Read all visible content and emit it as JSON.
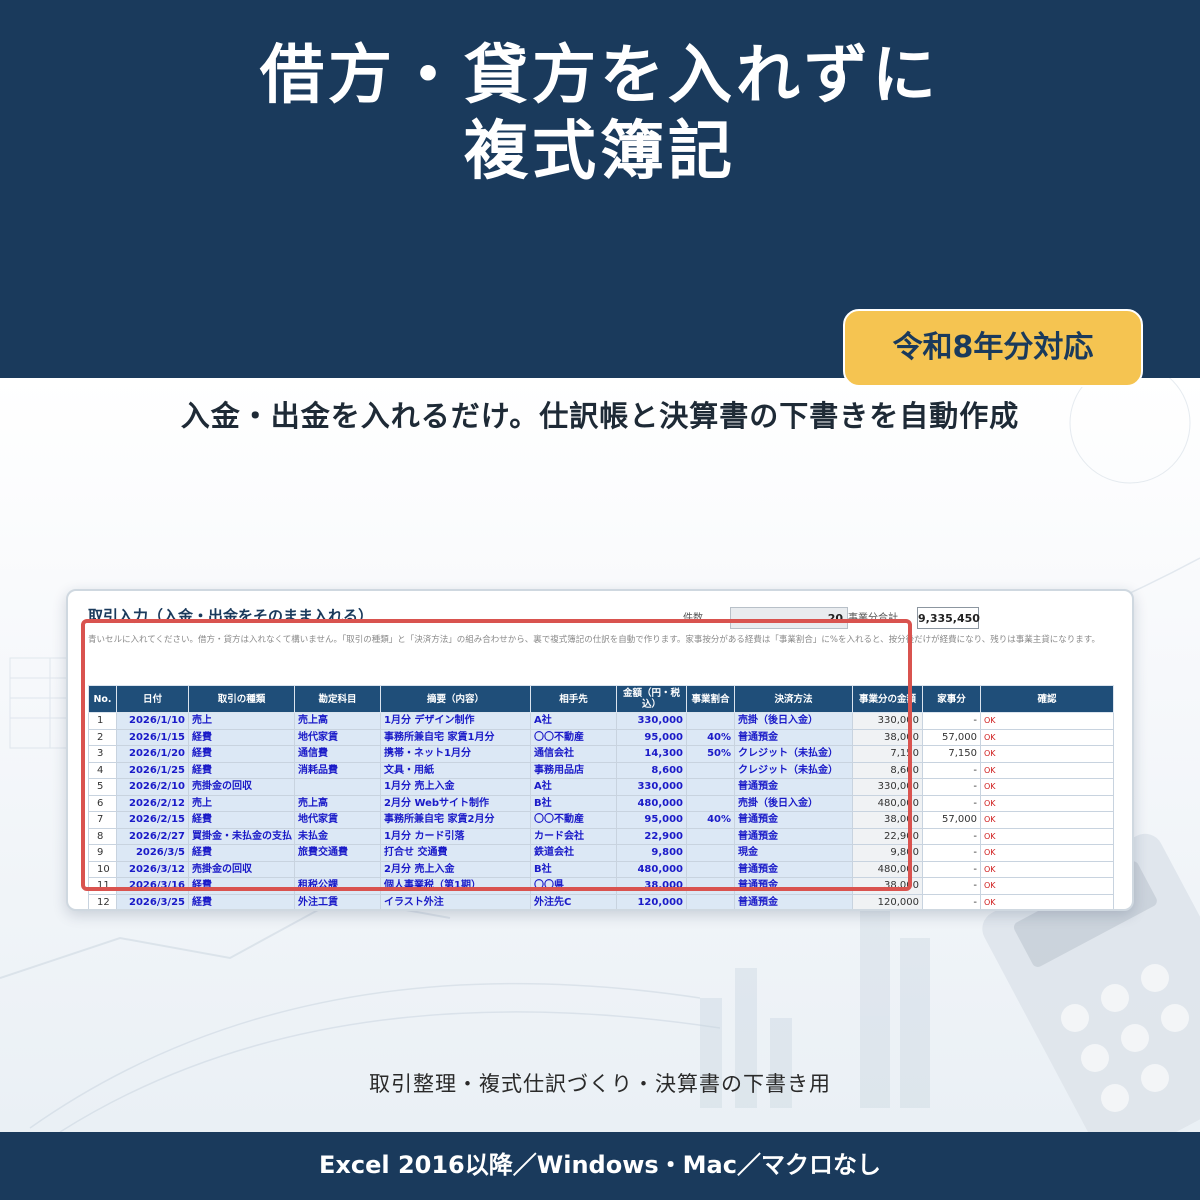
{
  "hero": {
    "title_line1": "借方・貸方を入れずに",
    "title_line2": "複式簿記",
    "badge": "令和8年分対応"
  },
  "subtitle": "入金・出金を入れるだけ。仕訳帳と決算書の下書きを自動作成",
  "sheet": {
    "title": "取引入力（入金・出金をそのまま入れる）",
    "count_label": "件数",
    "count_value": "20",
    "total_label": "事業分合計",
    "total_value": "9,335,450",
    "note": "青いセルに入れてください。借方・貸方は入れなくて構いません。「取引の種類」と「決済方法」の組み合わせから、裏で複式簿記の仕訳を自動で作ります。家事按分がある経費は「事業割合」に%を入れると、按分後だけが経費になり、残りは事業主貸になります。",
    "headers": [
      "No.",
      "日付",
      "取引の種類",
      "勘定科目",
      "摘要（内容）",
      "相手先",
      "金額（円・税込）",
      "事業割合",
      "決済方法",
      "事業分の金額",
      "家事分",
      "確認"
    ],
    "rows": [
      [
        "1",
        "2026/1/10",
        "売上",
        "売上高",
        "1月分 デザイン制作",
        "A社",
        "330,000",
        "",
        "売掛（後日入金）",
        "330,000",
        "-",
        "OK"
      ],
      [
        "2",
        "2026/1/15",
        "経費",
        "地代家賃",
        "事務所兼自宅 家賃1月分",
        "〇〇不動産",
        "95,000",
        "40%",
        "普通預金",
        "38,000",
        "57,000",
        "OK"
      ],
      [
        "3",
        "2026/1/20",
        "経費",
        "通信費",
        "携帯・ネット1月分",
        "通信会社",
        "14,300",
        "50%",
        "クレジット（未払金）",
        "7,150",
        "7,150",
        "OK"
      ],
      [
        "4",
        "2026/1/25",
        "経費",
        "消耗品費",
        "文具・用紙",
        "事務用品店",
        "8,600",
        "",
        "クレジット（未払金）",
        "8,600",
        "-",
        "OK"
      ],
      [
        "5",
        "2026/2/10",
        "売掛金の回収",
        "",
        "1月分 売上入金",
        "A社",
        "330,000",
        "",
        "普通預金",
        "330,000",
        "-",
        "OK"
      ],
      [
        "6",
        "2026/2/12",
        "売上",
        "売上高",
        "2月分 Webサイト制作",
        "B社",
        "480,000",
        "",
        "売掛（後日入金）",
        "480,000",
        "-",
        "OK"
      ],
      [
        "7",
        "2026/2/15",
        "経費",
        "地代家賃",
        "事務所兼自宅 家賃2月分",
        "〇〇不動産",
        "95,000",
        "40%",
        "普通預金",
        "38,000",
        "57,000",
        "OK"
      ],
      [
        "8",
        "2026/2/27",
        "買掛金・未払金の支払",
        "未払金",
        "1月分 カード引落",
        "カード会社",
        "22,900",
        "",
        "普通預金",
        "22,900",
        "-",
        "OK"
      ],
      [
        "9",
        "2026/3/5",
        "経費",
        "旅費交通費",
        "打合せ 交通費",
        "鉄道会社",
        "9,800",
        "",
        "現金",
        "9,800",
        "-",
        "OK"
      ],
      [
        "10",
        "2026/3/12",
        "売掛金の回収",
        "",
        "2月分 売上入金",
        "B社",
        "480,000",
        "",
        "普通預金",
        "480,000",
        "-",
        "OK"
      ],
      [
        "11",
        "2026/3/16",
        "経費",
        "租税公課",
        "個人事業税（第1期）",
        "〇〇県",
        "38,000",
        "",
        "普通預金",
        "38,000",
        "-",
        "OK"
      ],
      [
        "12",
        "2026/3/25",
        "経費",
        "外注工賃",
        "イラスト外注",
        "外注先C",
        "120,000",
        "",
        "普通預金",
        "120,000",
        "-",
        "OK"
      ]
    ]
  },
  "caption": "取引整理・複式仕訳づくり・決算書の下書き用",
  "footer": "Excel 2016以降／Windows・Mac／マクロなし",
  "colors": {
    "navy": "#1a3a5c",
    "badge_yellow": "#f5c451",
    "table_header": "#1f4e79",
    "input_cell": "#dce8f5",
    "highlight_frame": "#d9534f",
    "ok_text": "#d02020"
  }
}
